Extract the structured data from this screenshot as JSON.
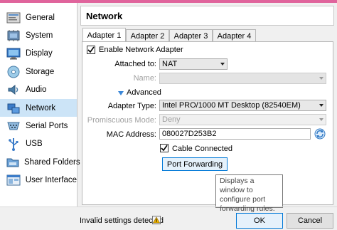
{
  "sidebar": {
    "items": [
      {
        "label": "General",
        "icon": "general-icon"
      },
      {
        "label": "System",
        "icon": "system-icon"
      },
      {
        "label": "Display",
        "icon": "display-icon"
      },
      {
        "label": "Storage",
        "icon": "storage-icon"
      },
      {
        "label": "Audio",
        "icon": "audio-icon"
      },
      {
        "label": "Network",
        "icon": "network-icon"
      },
      {
        "label": "Serial Ports",
        "icon": "serial-ports-icon"
      },
      {
        "label": "USB",
        "icon": "usb-icon"
      },
      {
        "label": "Shared Folders",
        "icon": "shared-folders-icon"
      },
      {
        "label": "User Interface",
        "icon": "user-interface-icon"
      }
    ],
    "selected": "Network"
  },
  "page": {
    "title": "Network"
  },
  "tabs": [
    "Adapter 1",
    "Adapter 2",
    "Adapter 3",
    "Adapter 4"
  ],
  "adapter": {
    "enable_label": "Enable Network Adapter",
    "enabled": true,
    "attached_label": "Attached to:",
    "attached_value": "NAT",
    "name_label": "Name:",
    "name_value": "",
    "advanced_label": "Advanced",
    "type_label": "Adapter Type:",
    "type_value": "Intel PRO/1000 MT Desktop (82540EM)",
    "promisc_label": "Promiscuous Mode:",
    "promisc_value": "Deny",
    "mac_label": "MAC Address:",
    "mac_value": "080027D253B2",
    "cable_label": "Cable Connected",
    "cable_connected": true,
    "port_forwarding_label": "Port Forwarding"
  },
  "tooltip": {
    "text": "Displays a window to configure port forwarding rules."
  },
  "footer": {
    "status": "Invalid settings detected",
    "ok_label": "OK",
    "cancel_label": "Cancel"
  },
  "colors": {
    "selected_bg": "#cce4f7",
    "accent_bar": "#e0649c",
    "button_focus": "#0078d7"
  }
}
